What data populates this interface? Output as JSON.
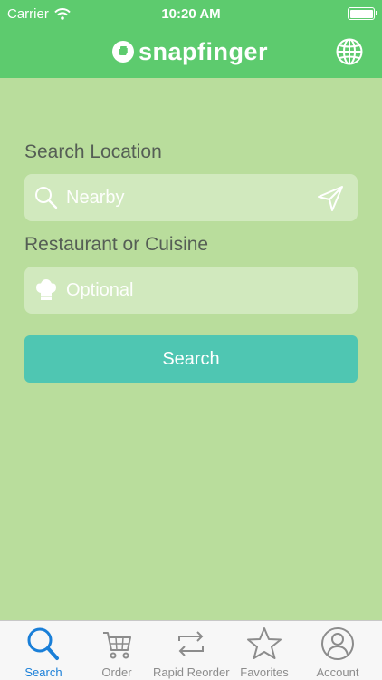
{
  "status_bar": {
    "carrier": "Carrier",
    "time": "10:20 AM"
  },
  "header": {
    "logo_text": "snapfinger",
    "globe_icon": "globe-icon"
  },
  "form": {
    "location_label": "Search Location",
    "location_placeholder": "Nearby",
    "cuisine_label": "Restaurant or Cuisine",
    "cuisine_placeholder": "Optional",
    "search_button": "Search"
  },
  "tabs": [
    {
      "label": "Search",
      "icon": "search-icon",
      "active": true
    },
    {
      "label": "Order",
      "icon": "cart-icon",
      "active": false
    },
    {
      "label": "Rapid Reorder",
      "icon": "repeat-icon",
      "active": false
    },
    {
      "label": "Favorites",
      "icon": "star-icon",
      "active": false
    },
    {
      "label": "Account",
      "icon": "user-icon",
      "active": false
    }
  ],
  "colors": {
    "header": "#5dcb6e",
    "background": "#b9dd9c",
    "button": "#4fc6b2",
    "active_tab": "#1a7fd8"
  }
}
